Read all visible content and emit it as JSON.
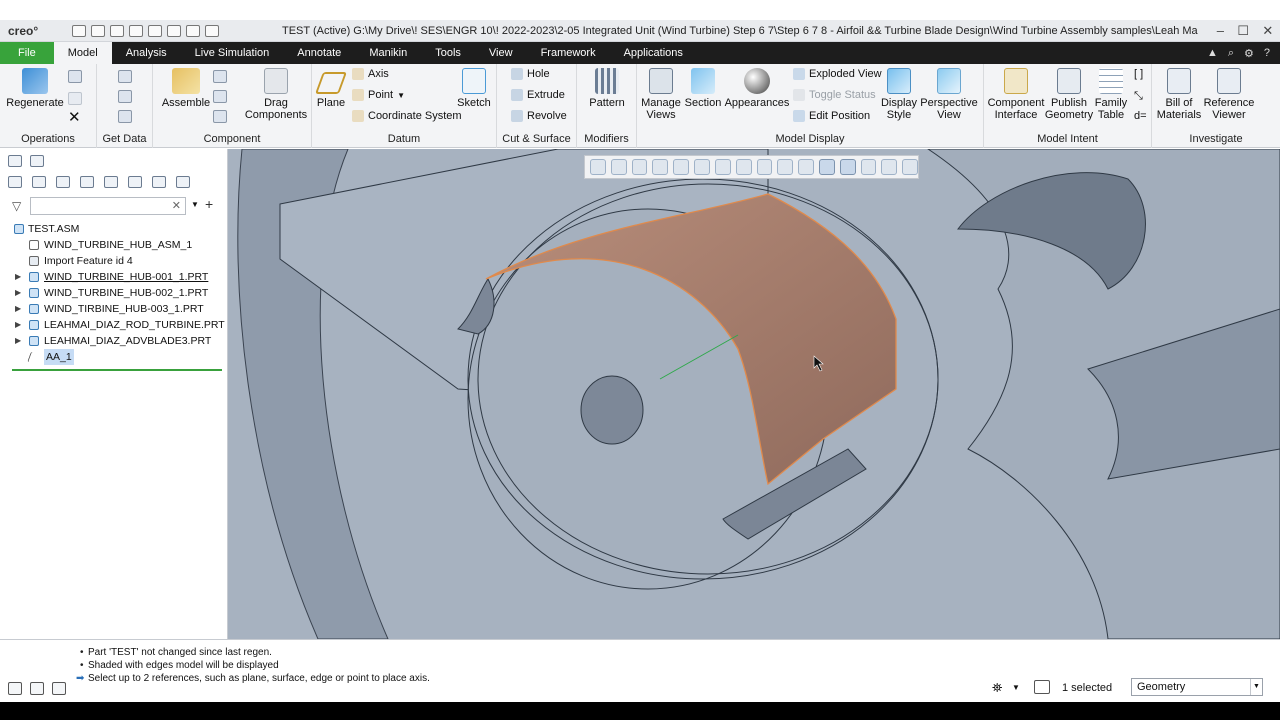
{
  "app": {
    "logo": "creo°",
    "title": "TEST (Active) G:\\My Drive\\! SES\\ENGR 10\\! 2022-2023\\2-05 Integrated Unit (Wind Turbine) Step 6 7\\Step 6 7 8 - Airfoil && Turbine Blade Design\\Wind Turbine Assembly samples\\Leah Ma",
    "window_controls": [
      "–",
      "☐",
      "✕"
    ]
  },
  "tabs": [
    {
      "label": "File"
    },
    {
      "label": "Model"
    },
    {
      "label": "Analysis"
    },
    {
      "label": "Live Simulation"
    },
    {
      "label": "Annotate"
    },
    {
      "label": "Manikin"
    },
    {
      "label": "Tools"
    },
    {
      "label": "View"
    },
    {
      "label": "Framework"
    },
    {
      "label": "Applications"
    }
  ],
  "ribbon": {
    "operations": {
      "regenerate": "Regenerate",
      "label": "Operations"
    },
    "get_data": {
      "label": "Get Data"
    },
    "component": {
      "assemble": "Assemble",
      "drag": "Drag Components",
      "label": "Component"
    },
    "datum": {
      "plane": "Plane",
      "axis": "Axis",
      "point": "Point",
      "csys": "Coordinate System",
      "sketch": "Sketch",
      "label": "Datum"
    },
    "cut_surface": {
      "hole": "Hole",
      "extrude": "Extrude",
      "revolve": "Revolve",
      "label": "Cut & Surface"
    },
    "modifiers": {
      "pattern": "Pattern",
      "label": "Modifiers"
    },
    "model_display": {
      "manage_views": "Manage Views",
      "section": "Section",
      "appearances": "Appearances",
      "exploded": "Exploded View",
      "toggle": "Toggle Status",
      "edit_pos": "Edit Position",
      "display_style": "Display Style",
      "perspective": "Perspective View",
      "label": "Model Display"
    },
    "model_intent": {
      "component_interface": "Component Interface",
      "publish": "Publish Geometry",
      "family": "Family Table",
      "label": "Model Intent"
    },
    "investigate": {
      "bom": "Bill of Materials",
      "reference": "Reference Viewer",
      "label": "Investigate"
    }
  },
  "model_tree": {
    "root": "TEST.ASM",
    "items": [
      {
        "label": "WIND_TURBINE_HUB_ASM_1"
      },
      {
        "label": "Import Feature id 4"
      },
      {
        "label": "WIND_TURBINE_HUB-001_1.PRT"
      },
      {
        "label": "WIND_TURBINE_HUB-002_1.PRT"
      },
      {
        "label": "WIND_TIRBINE_HUB-003_1.PRT"
      },
      {
        "label": "LEAHMAI_DIAZ_ROD_TURBINE.PRT"
      },
      {
        "label": "LEAHMAI_DIAZ_ADVBLADE3.PRT"
      },
      {
        "label": "AA_1"
      }
    ]
  },
  "status": {
    "messages": [
      "Part 'TEST' not changed since last regen.",
      "Shaded with edges model will be displayed",
      "Select up to 2 references, such as plane, surface, edge or point to place axis."
    ],
    "selected": "1 selected",
    "filter": "Geometry"
  },
  "colors": {
    "file_tab": "#38a33b",
    "viewport_bg": "#a6b1bf",
    "highlight": "#d9874c"
  }
}
